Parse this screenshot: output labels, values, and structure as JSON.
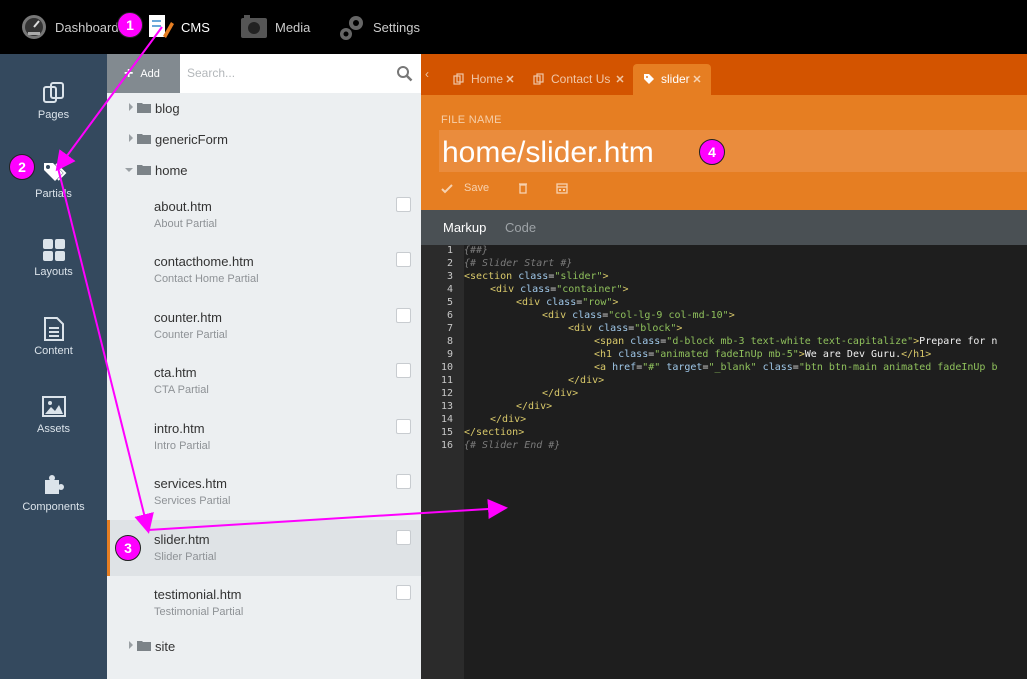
{
  "topbar": {
    "items": [
      {
        "label": "Dashboard",
        "icon": "speedometer-icon"
      },
      {
        "label": "CMS",
        "icon": "cms-pencil-icon"
      },
      {
        "label": "Media",
        "icon": "camera-icon"
      },
      {
        "label": "Settings",
        "icon": "gears-icon"
      }
    ]
  },
  "sidebar": {
    "items": [
      {
        "label": "Pages",
        "icon": "pages-icon"
      },
      {
        "label": "Partials",
        "icon": "tags-icon"
      },
      {
        "label": "Layouts",
        "icon": "grid-icon"
      },
      {
        "label": "Content",
        "icon": "document-icon"
      },
      {
        "label": "Assets",
        "icon": "image-icon"
      },
      {
        "label": "Components",
        "icon": "puzzle-icon"
      }
    ]
  },
  "list": {
    "add_label": "Add",
    "search_placeholder": "Search...",
    "folders": [
      "blog",
      "genericForm",
      "home",
      "site"
    ],
    "files": [
      {
        "name": "about.htm",
        "desc": "About Partial"
      },
      {
        "name": "contacthome.htm",
        "desc": "Contact Home Partial"
      },
      {
        "name": "counter.htm",
        "desc": "Counter Partial"
      },
      {
        "name": "cta.htm",
        "desc": "CTA Partial"
      },
      {
        "name": "intro.htm",
        "desc": "Intro Partial"
      },
      {
        "name": "services.htm",
        "desc": "Services Partial"
      },
      {
        "name": "slider.htm",
        "desc": "Slider Partial"
      },
      {
        "name": "testimonial.htm",
        "desc": "Testimonial Partial"
      }
    ]
  },
  "editor": {
    "tabs": [
      "Home",
      "Contact Us",
      "slider"
    ],
    "file_name_label": "FILE NAME",
    "file_name": "home/slider.htm",
    "save_label": "Save",
    "subtabs": [
      "Markup",
      "Code"
    ],
    "line_numbers": [
      "1",
      "2",
      "3",
      "4",
      "5",
      "6",
      "7",
      "8",
      "9",
      "10",
      "11",
      "12",
      "13",
      "14",
      "15",
      "16"
    ],
    "code": {
      "l1": "{##}",
      "l2": "{# Slider Start #}",
      "l16": "{# Slider End #}",
      "lt": "<",
      "gt": ">",
      "eq": "=",
      "sp": " ",
      "tag_section": "section",
      "tag_div": "div",
      "tag_span": "span",
      "tag_h1": "h1",
      "tag_a": "a",
      "tag_close_div": "/div",
      "tag_close_section": "/section",
      "tag_close_h1": "/h1",
      "attr_class": "class",
      "attr_href": "href",
      "attr_target": "target",
      "v_slider": "\"slider\"",
      "v_container": "\"container\"",
      "v_row": "\"row\"",
      "v_col": "\"col-lg-9 col-md-10\"",
      "v_block": "\"block\"",
      "v_span": "\"d-block mb-3 text-white text-capitalize\"",
      "span_text": "Prepare for n",
      "v_h1": "\"animated fadeInUp mb-5\"",
      "h1_text": "We are Dev Guru.",
      "v_hash": "\"#\"",
      "v_blank": "\"_blank\"",
      "v_btn": "\"btn btn-main animated fadeInUp b"
    }
  },
  "annotations": [
    "1",
    "2",
    "3",
    "4"
  ],
  "colors": {
    "accent_orange": "#e67e22",
    "tab_bar": "#d35400",
    "annotation": "#ff00ff",
    "sidebar": "#34495e"
  }
}
